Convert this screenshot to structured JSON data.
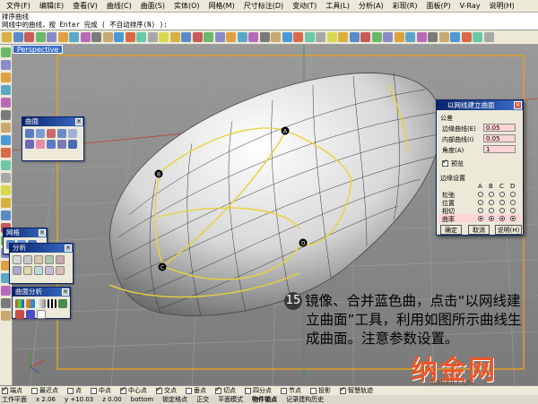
{
  "menubar": [
    "文件(F)",
    "编辑(E)",
    "查看(V)",
    "曲线(C)",
    "曲面(S)",
    "实体(O)",
    "网格(M)",
    "尺寸标注(D)",
    "变动(T)",
    "工具(L)",
    "分析(A)",
    "彩现(R)",
    "面板(P)",
    "V-Ray",
    "说明(H)"
  ],
  "command": {
    "line1": "排序曲线",
    "line2": "网线中的曲线，按 Enter 完成 ( 不自动排序(N) ):"
  },
  "viewport": {
    "label": "Perspective"
  },
  "curve_labels": [
    "A",
    "B",
    "C",
    "D"
  ],
  "panels": {
    "surface": {
      "title": "曲面"
    },
    "grid": {
      "title": "网格"
    },
    "analysis": {
      "title": "分析"
    },
    "surface_analysis": {
      "title": "曲面分析"
    }
  },
  "dialog": {
    "title": "以网线建立曲面",
    "group_tolerance": "公差",
    "edge_label": "边缘曲线(E)",
    "edge_value": "0.05",
    "inner_label": "内部曲线(I)",
    "inner_value": "0.05",
    "angle_label": "角度(A)",
    "angle_value": "1",
    "preview_label": "预览",
    "group_edge": "边缘设置",
    "edge_cols": [
      "A",
      "B",
      "C",
      "D"
    ],
    "rows": [
      "松弛",
      "位置",
      "相切",
      "曲率"
    ],
    "ok": "确定",
    "cancel": "取消",
    "help": "说明(H)"
  },
  "caption": {
    "step": "15",
    "text": "镜像、合并蓝色曲，点击“以网线建立曲面”工具，利用如图所示曲线生成曲面。注意参数设置。"
  },
  "watermark": {
    "main": "纳金网",
    "sub": "NARKII.COM"
  },
  "snaps": [
    "端点",
    "最近点",
    "点",
    "中点",
    "中心点",
    "交点",
    "垂点",
    "切点",
    "四分点",
    "节点",
    "投影",
    "智慧轨迹"
  ],
  "statusbar": {
    "cplane": "工作平面",
    "x": "x 2.06",
    "y": "y +10.03",
    "z": "z 0.00",
    "layer": "bottom",
    "lock_grid": "锁定格点",
    "ortho": "正交",
    "planar": "平面模式",
    "osnap": "物件锁点",
    "history": "记录建构历史"
  },
  "colors": {
    "accent": "#0a246a",
    "curve_yellow": "#e8d23a",
    "frame_orange": "#e0a020",
    "highlight_red": "#ffd4d4",
    "watermark": "#e8572a"
  }
}
